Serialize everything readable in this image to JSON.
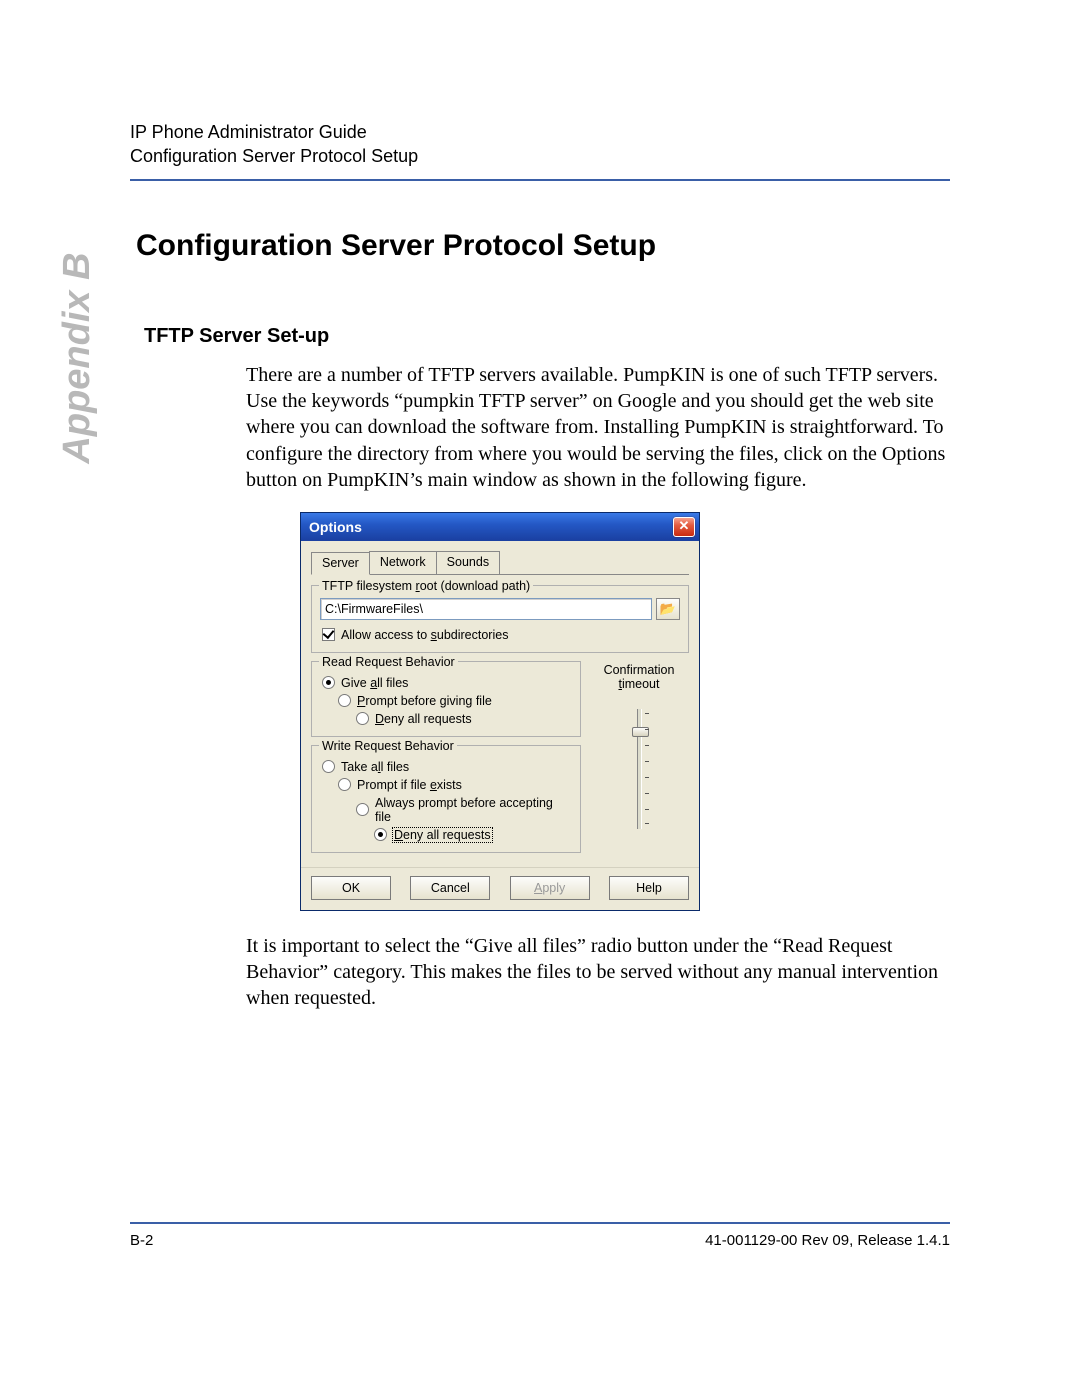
{
  "header": {
    "line1": "IP Phone Administrator Guide",
    "line2": "Configuration Server Protocol Setup"
  },
  "appendix": "Appendix B",
  "title": "Configuration Server Protocol Setup",
  "subheading": "TFTP Server Set-up",
  "para1": "There are a number of TFTP servers available. PumpKIN is one of such TFTP servers. Use the keywords “pumpkin TFTP server” on Google and you should get the web site where you can download the software from. Installing PumpKIN is straightforward. To configure the directory from where you would be serving the files, click on the Options button on PumpKIN’s main window as shown in the following figure.",
  "para2": "It is important to select the “Give all files” radio button under the “Read Request Behavior” category. This makes the files to be served without any manual intervention when requested.",
  "dialog": {
    "title": "Options",
    "close_glyph": "✕",
    "tabs": [
      "Server",
      "Network",
      "Sounds"
    ],
    "active_tab_index": 0,
    "fs_root_legend": "TFTP filesystem root (download path)",
    "path_value": "C:\\FirmwareFiles\\",
    "browse_glyph": "📂",
    "allow_subdirs": "Allow access to subdirectories",
    "allow_subdirs_checked": true,
    "read_legend": "Read Request Behavior",
    "read_options": [
      {
        "label": "Give all files",
        "ak": "a",
        "indent": 0,
        "selected": true
      },
      {
        "label": "Prompt before giving file",
        "ak": "P",
        "indent": 1,
        "selected": false
      },
      {
        "label": "Deny all requests",
        "ak": "D",
        "indent": 2,
        "selected": false
      }
    ],
    "write_legend": "Write Request Behavior",
    "write_options": [
      {
        "label": "Take all files",
        "ak": "l",
        "indent": 0,
        "selected": false
      },
      {
        "label": "Prompt if file exists",
        "ak": "e",
        "indent": 1,
        "selected": false
      },
      {
        "label": "Always prompt before accepting file",
        "ak": "",
        "indent": 2,
        "selected": false
      },
      {
        "label": "Deny all requests",
        "ak": "D",
        "indent": 3,
        "selected": true,
        "focused": true
      }
    ],
    "conf_label1": "Confirmation",
    "conf_label2": "timeout",
    "buttons": {
      "ok": "OK",
      "cancel": "Cancel",
      "apply": "Apply",
      "help": "Help"
    }
  },
  "footer": {
    "left": "B-2",
    "right": "41-001129-00 Rev 09, Release 1.4.1"
  }
}
